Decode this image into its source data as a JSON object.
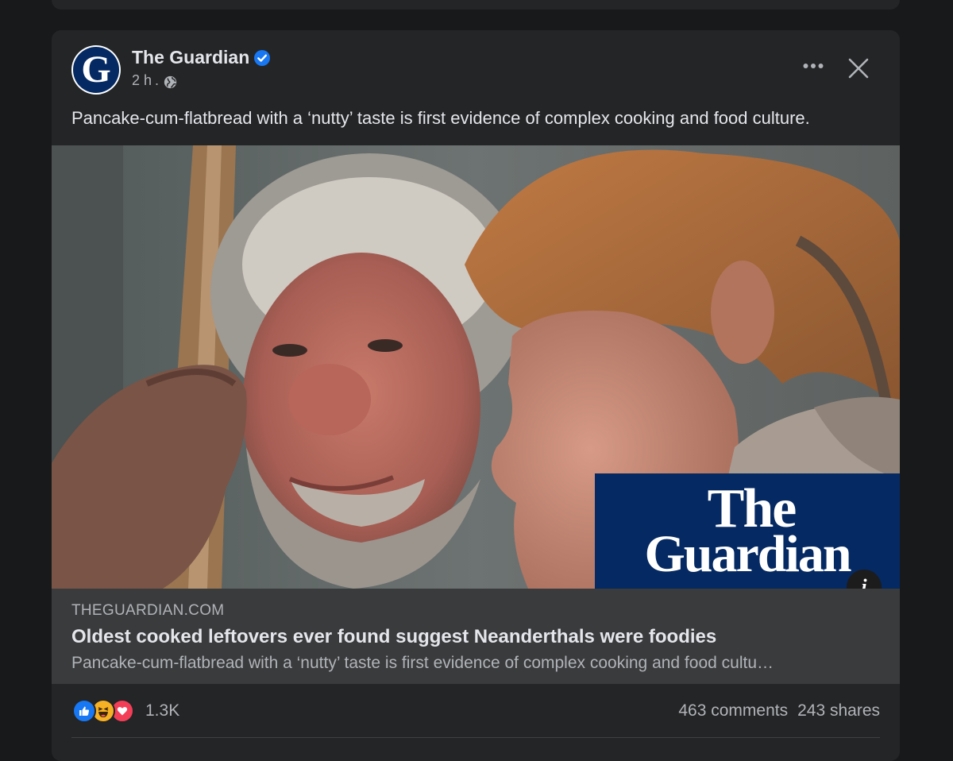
{
  "post": {
    "page_name": "The Guardian",
    "verified": true,
    "time": "2 h",
    "separator": ".",
    "audience_icon": "globe-icon",
    "avatar_letter": "G",
    "caption": "Pancake-cum-flatbread with a ‘nutty’ taste is first evidence of complex cooking and food culture."
  },
  "image": {
    "overlay_line1": "The",
    "overlay_line2": "Guardian",
    "info_label": "i"
  },
  "link": {
    "domain": "THEGUARDIAN.COM",
    "headline": "Oldest cooked leftovers ever found suggest Neanderthals were foodies",
    "description": "Pancake-cum-flatbread with a ‘nutty’ taste is first evidence of complex cooking and food cultu…"
  },
  "engagement": {
    "reaction_icons": [
      "like-icon",
      "haha-icon",
      "love-icon"
    ],
    "reaction_count": "1.3K",
    "comments": "463 comments",
    "shares": "243 shares"
  },
  "colors": {
    "background": "#18191a",
    "card": "#242526",
    "link_preview": "#3a3b3c",
    "guardian_blue": "#052962",
    "verified_blue": "#1877f2"
  }
}
